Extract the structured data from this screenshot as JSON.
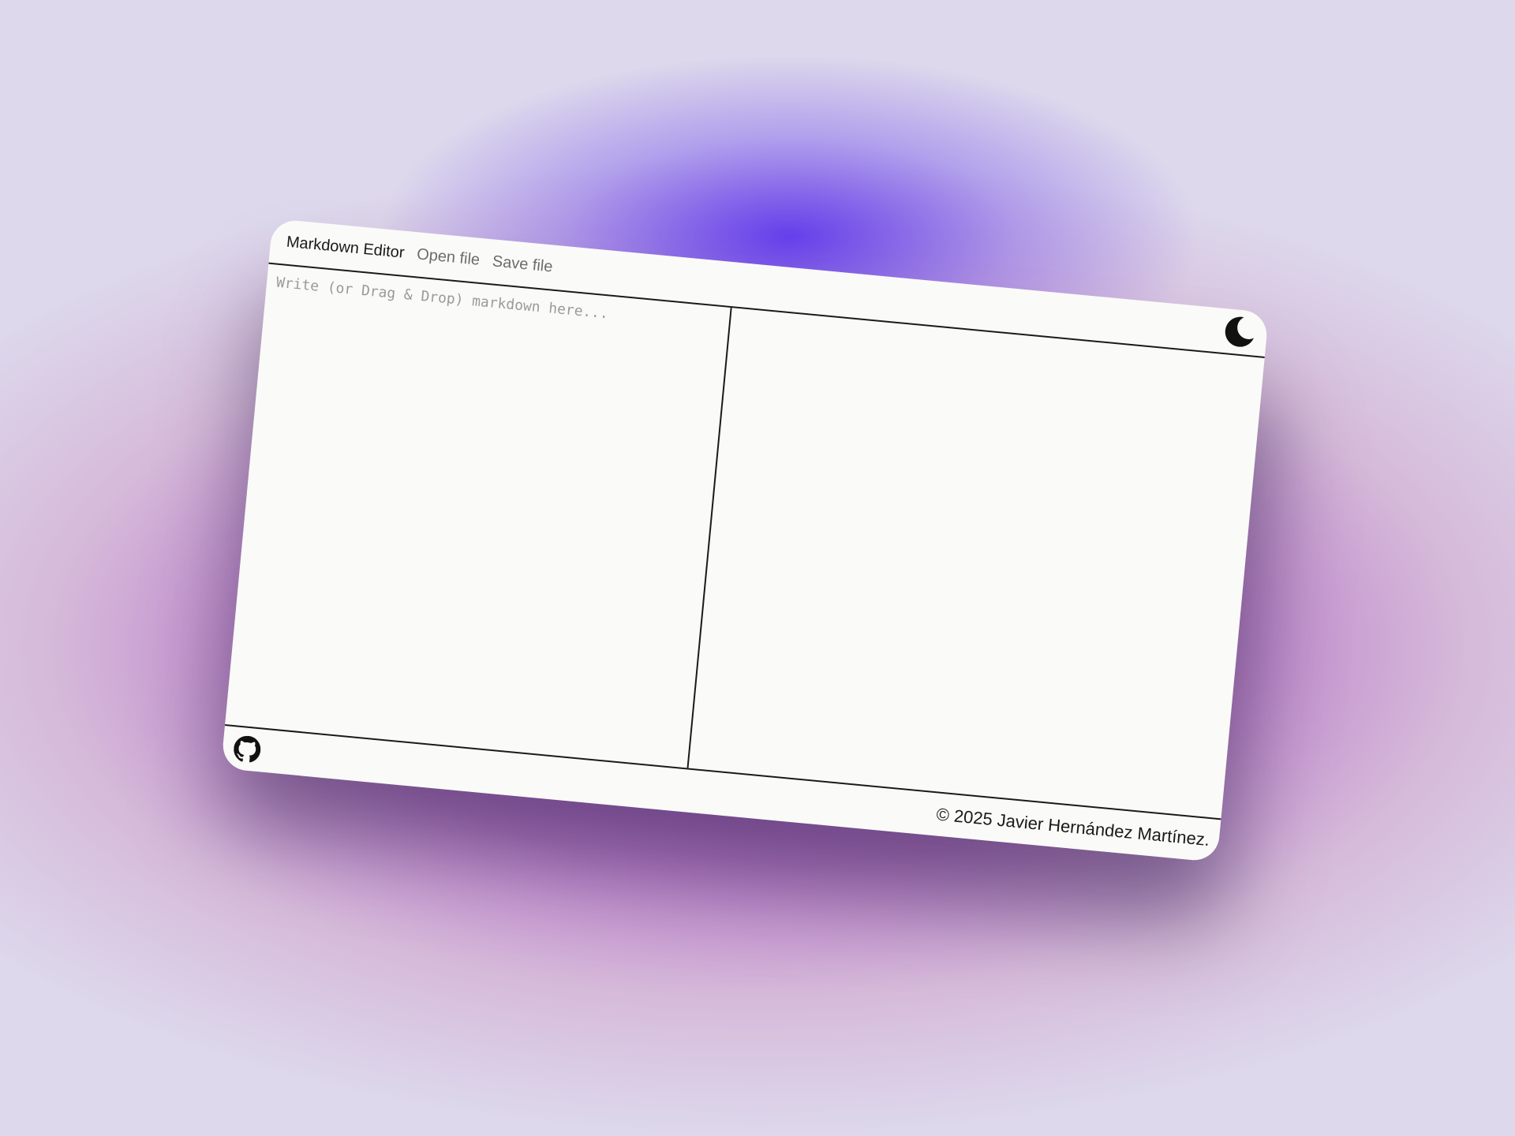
{
  "header": {
    "brand": "Markdown Editor",
    "open_file": "Open file",
    "save_file": "Save file",
    "theme_toggle_icon": "moon-icon"
  },
  "editor": {
    "placeholder": "Write (or Drag & Drop) markdown here...",
    "value": ""
  },
  "preview": {
    "content": ""
  },
  "footer": {
    "github_icon": "github-icon",
    "copyright": "© 2025 Javier Hernández Martínez."
  },
  "colors": {
    "window_background": "#fafaf8",
    "border": "#1a1a1a",
    "muted_text": "#6c6c6c",
    "backdrop_purple": "#5f37eb",
    "backdrop_magenta": "#b464b8",
    "backdrop_light": "#ddd8ec"
  }
}
